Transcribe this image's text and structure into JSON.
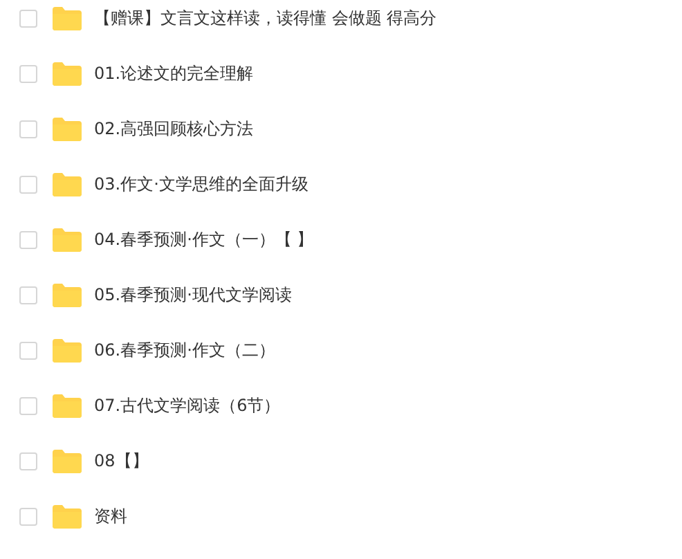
{
  "files": [
    {
      "name": "【赠课】文言文这样读，读得懂 会做题 得高分",
      "checked": false
    },
    {
      "name": "01.论述文的完全理解",
      "checked": false
    },
    {
      "name": "02.高强回顾核心方法",
      "checked": false
    },
    {
      "name": "03.作文·文学思维的全面升级",
      "checked": false
    },
    {
      "name": "04.春季预测·作文（一）【 】",
      "checked": false
    },
    {
      "name": "05.春季预测·现代文学阅读",
      "checked": false
    },
    {
      "name": "06.春季预测·作文（二）",
      "checked": false
    },
    {
      "name": "07.古代文学阅读（6节）",
      "checked": false
    },
    {
      "name": "08【】",
      "checked": false
    },
    {
      "name": "资料",
      "checked": false
    }
  ]
}
